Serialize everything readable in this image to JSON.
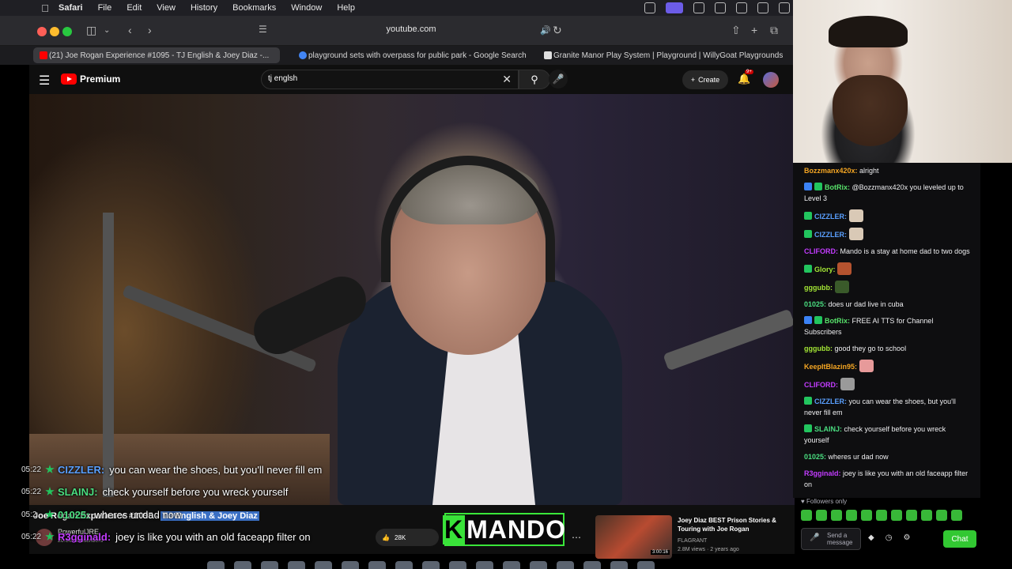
{
  "menubar": {
    "app": "Safari",
    "items": [
      "File",
      "Edit",
      "View",
      "History",
      "Bookmarks",
      "Window",
      "Help"
    ]
  },
  "toolbar": {
    "url": "youtube.com"
  },
  "tabs": [
    {
      "label": "(21) Joe Rogan Experience #1095 - TJ English & Joey Diaz -...",
      "active": true,
      "favicon_color": "#ff0000"
    },
    {
      "label": "playground sets with overpass for public park - Google Search",
      "active": false,
      "favicon_color": "#4285f4"
    },
    {
      "label": "Granite Manor Play System | Playground | WillyGoat Playgrounds",
      "active": false,
      "favicon_color": "#e0e0e0"
    }
  ],
  "youtube": {
    "logo": "Premium",
    "search_value": "tj englsh",
    "create_label": "Create",
    "notification_count": "9+"
  },
  "video_overlay": [
    {
      "time": "05:22",
      "name": "CIZZLER:",
      "name_color": "#5aa0ff",
      "text": "you can wear the shoes, but you'll never fill em"
    },
    {
      "time": "05:22",
      "name": "SLAINJ:",
      "name_color": "#4ade80",
      "text": "check yourself before you wreck yourself"
    },
    {
      "time": "05:2",
      "name": "01025:",
      "name_color": "#4ade80",
      "text": "wheres ur dad now"
    },
    {
      "time": "05:22",
      "name": "R3gginald:",
      "name_color": "#c33cff",
      "text": "joey is like you with an old faceapp filter on"
    }
  ],
  "video_info": {
    "title_prefix": "Joe Rogan Experience #1095 - ",
    "title_highlight": "TJ English & Joey Diaz",
    "channel": "PowerfulJRE",
    "subscribers": "20.8M subscribers",
    "likes": "28K"
  },
  "mando_overlay": {
    "k": "K",
    "text": "MANDO"
  },
  "recommended": {
    "title": "Joey Diaz BEST Prison Stories & Touring with Joe Rogan",
    "channel": "FLAGRANT",
    "views": "2.8M views · 2 years ago",
    "duration": "3:00:16"
  },
  "chat": {
    "messages": [
      {
        "name": "Bozzmanx420x:",
        "color": "#f5a623",
        "text": "alright",
        "badges": []
      },
      {
        "name": "BotRix:",
        "color": "#58e36b",
        "text": "@Bozzmanx420x you leveled up to Level 3",
        "badges": [
          "#3b82f6",
          "#22c55e"
        ]
      },
      {
        "name": "CIZZLER:",
        "color": "#5aa0ff",
        "text": "",
        "badges": [
          "#22c55e"
        ],
        "emote": "#d9c9b6"
      },
      {
        "name": "CIZZLER:",
        "color": "#5aa0ff",
        "text": "",
        "badges": [
          "#22c55e"
        ],
        "emote": "#d9c9b6"
      },
      {
        "name": "CLIFORD:",
        "color": "#c33cff",
        "text": "Mando is a stay at home dad to two dogs",
        "badges": []
      },
      {
        "name": "Glory:",
        "color": "#a3e635",
        "text": "",
        "badges": [
          "#22c55e"
        ],
        "emote": "#b5532f"
      },
      {
        "name": "gggubb:",
        "color": "#a3e635",
        "text": "",
        "badges": [],
        "emote": "#3a5a2a"
      },
      {
        "name": "01025:",
        "color": "#4ade80",
        "text": "does ur dad live in cuba",
        "badges": []
      },
      {
        "name": "BotRix:",
        "color": "#58e36b",
        "text": "FREE AI TTS for Channel Subscribers",
        "badges": [
          "#3b82f6",
          "#22c55e"
        ]
      },
      {
        "name": "gggubb:",
        "color": "#a3e635",
        "text": "good they go to school",
        "badges": []
      },
      {
        "name": "KeepItBlazin95:",
        "color": "#f5a623",
        "text": "",
        "badges": [],
        "emote": "#e79a9a"
      },
      {
        "name": "CLIFORD:",
        "color": "#c33cff",
        "text": "",
        "badges": [],
        "emote": "#9a9a9a"
      },
      {
        "name": "CIZZLER:",
        "color": "#5aa0ff",
        "text": "you can wear the shoes, but you'll never fill em",
        "badges": [
          "#22c55e"
        ]
      },
      {
        "name": "SLAINJ:",
        "color": "#4ade80",
        "text": "check yourself before you wreck yourself",
        "badges": [
          "#22c55e"
        ]
      },
      {
        "name": "01025:",
        "color": "#4ade80",
        "text": "wheres ur dad now",
        "badges": []
      },
      {
        "name": "R3gginald:",
        "color": "#c33cff",
        "text": "joey is like you with an old faceapp filter on",
        "badges": []
      }
    ],
    "followers_only": "Followers only",
    "input_placeholder": "Send a message",
    "send_label": "Chat"
  }
}
